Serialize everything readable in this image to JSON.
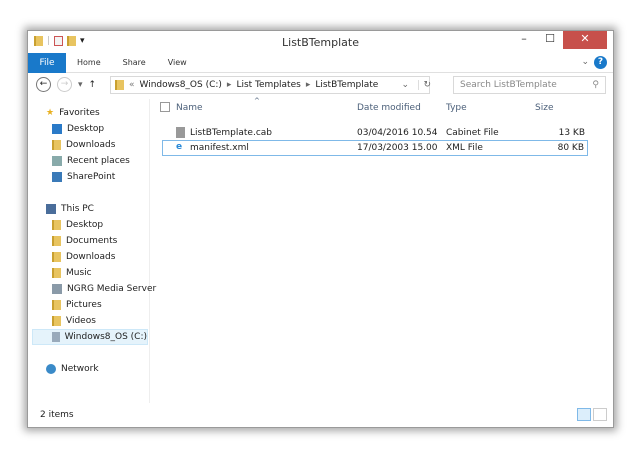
{
  "window": {
    "title": "ListBTemplate"
  },
  "ribbon": {
    "file": "File",
    "tabs": [
      "Home",
      "Share",
      "View"
    ]
  },
  "address": {
    "path": [
      "Windows8_OS (C:)",
      "List Templates",
      "ListBTemplate"
    ],
    "search_placeholder": "Search ListBTemplate"
  },
  "sidebar": {
    "favorites": "Favorites",
    "fav_items": [
      "Desktop",
      "Downloads",
      "Recent places",
      "SharePoint"
    ],
    "this_pc": "This PC",
    "pc_items": [
      "Desktop",
      "Documents",
      "Downloads",
      "Music",
      "NGRG Media Server",
      "Pictures",
      "Videos",
      "Windows8_OS (C:)"
    ],
    "network": "Network"
  },
  "columns": {
    "name": "Name",
    "date": "Date modified",
    "type": "Type",
    "size": "Size"
  },
  "files": [
    {
      "name": "ListBTemplate.cab",
      "date": "03/04/2016 10.54",
      "type": "Cabinet File",
      "size": "13 KB"
    },
    {
      "name": "manifest.xml",
      "date": "17/03/2003 15.00",
      "type": "XML File",
      "size": "80 KB"
    }
  ],
  "status": {
    "count": "2 items"
  },
  "colors": {
    "accent": "#1979ca",
    "close": "#c7504b"
  }
}
